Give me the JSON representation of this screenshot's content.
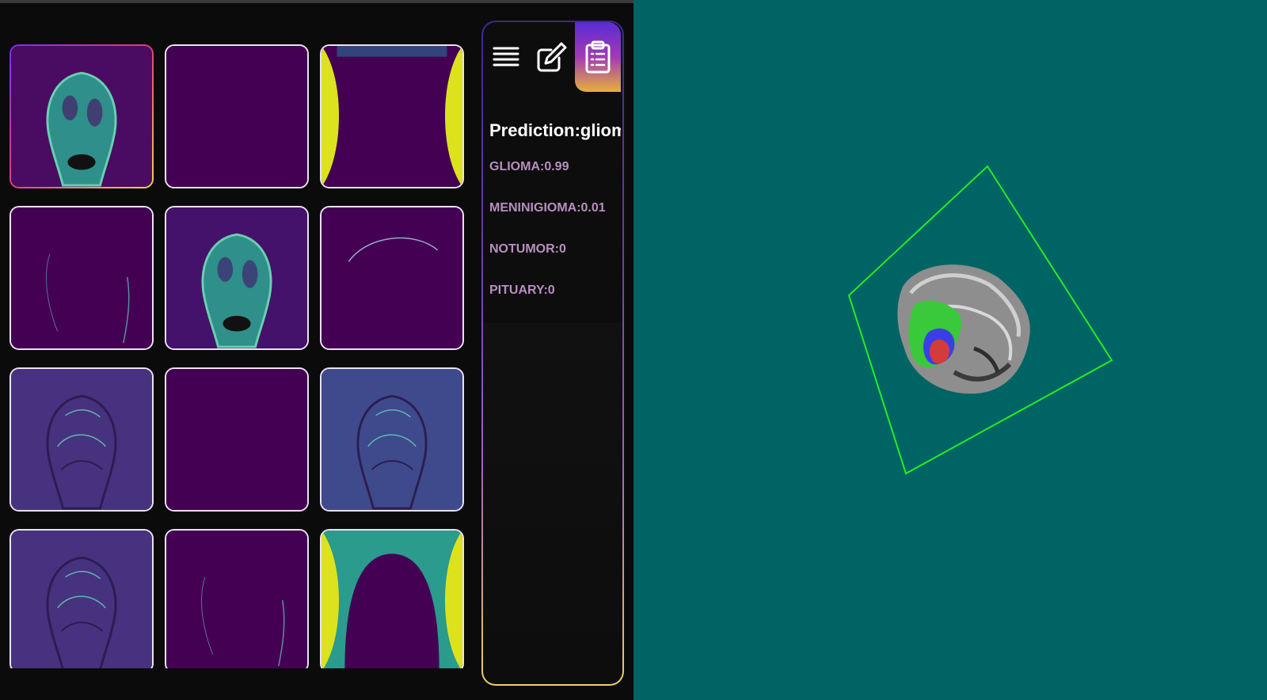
{
  "grid": {
    "tiles": [
      {
        "kind": "brain",
        "tone": "viridis",
        "selected": true
      },
      {
        "kind": "empty"
      },
      {
        "kind": "edges-yellow"
      },
      {
        "kind": "faint-lines"
      },
      {
        "kind": "brain",
        "tone": "viridis"
      },
      {
        "kind": "arc"
      },
      {
        "kind": "emboss",
        "tone": "purple"
      },
      {
        "kind": "empty"
      },
      {
        "kind": "emboss",
        "tone": "blue"
      },
      {
        "kind": "emboss",
        "tone": "purple"
      },
      {
        "kind": "faint-lines"
      },
      {
        "kind": "edges-yellow-dark"
      }
    ]
  },
  "toolbar": {
    "menu_icon": "menu-icon",
    "edit_icon": "edit-icon",
    "report_icon": "clipboard-icon"
  },
  "prediction": {
    "title": "Prediction:glioma",
    "scores": [
      "GLIOMA:0.99",
      "MENINIGIOMA:0.01",
      "NOTUMOR:0",
      "PITUARY:0"
    ]
  },
  "colors": {
    "viewer_bg": "#006464",
    "bounding_box": "#22ee22",
    "tumor_green": "#39c93a",
    "tumor_blue": "#3b3ee8",
    "tumor_red": "#d43b3b"
  }
}
